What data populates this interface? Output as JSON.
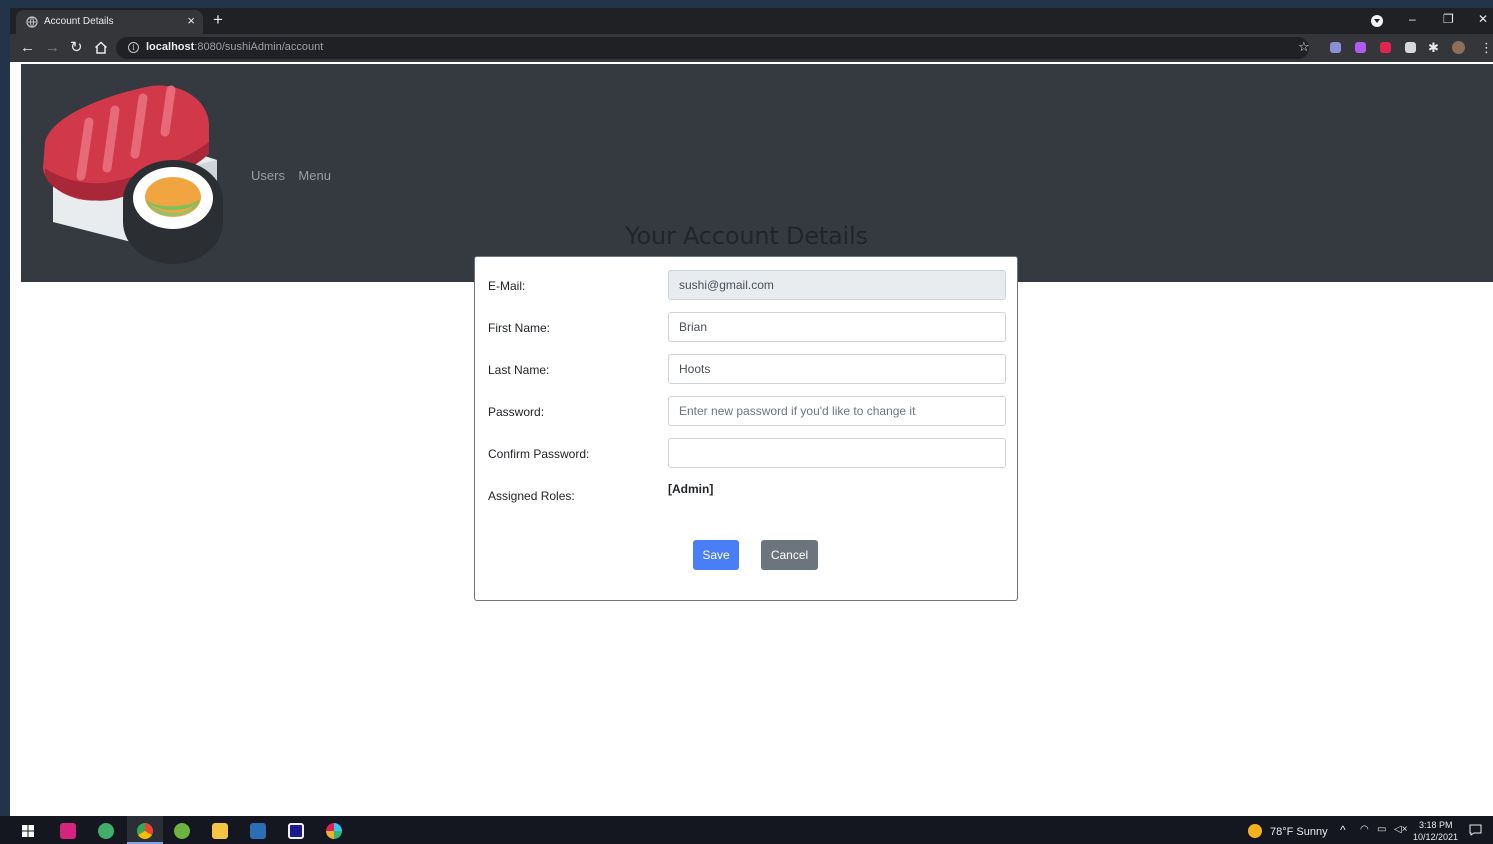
{
  "browser": {
    "tab_title": "Account Details",
    "tab_close": "×",
    "new_tab": "+",
    "url_host": "localhost",
    "url_path": ":8080/sushiAdmin/account",
    "window_controls": {
      "minimize": "–",
      "restore": "❐",
      "close": "✕"
    },
    "extension_colors": [
      "#8a8fd6",
      "#b05cf0",
      "#e0244b",
      "#d8d8d8",
      "#e8eaed"
    ]
  },
  "navbar": {
    "links": [
      "Users",
      "Menu"
    ],
    "background": "#343a40"
  },
  "page": {
    "heading": "Your Account Details"
  },
  "form": {
    "email": {
      "label": "E-Mail:",
      "value": "sushi@gmail.com"
    },
    "first_name": {
      "label": "First Name:",
      "value": "Brian"
    },
    "last_name": {
      "label": "Last Name:",
      "value": "Hoots"
    },
    "password": {
      "label": "Password:",
      "value": "",
      "placeholder": "Enter new password if you'd like to change it"
    },
    "confirm_password": {
      "label": "Confirm Password:",
      "value": ""
    },
    "roles": {
      "label": "Assigned Roles:",
      "value": "[Admin]"
    },
    "save_label": "Save",
    "cancel_label": "Cancel",
    "save_color": "#4a7ef7",
    "cancel_color": "#6c757d"
  },
  "taskbar": {
    "weather": "78°F  Sunny",
    "time": "3:18 PM",
    "date": "10/12/2021"
  }
}
